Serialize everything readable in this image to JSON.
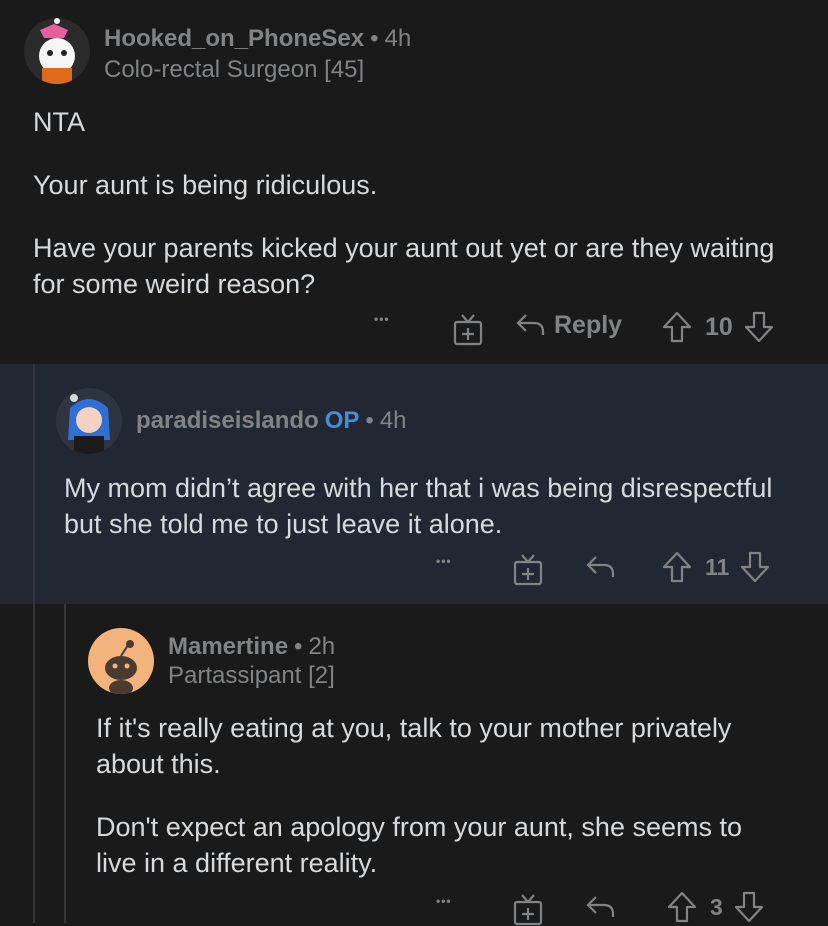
{
  "comments": [
    {
      "author": "Hooked_on_PhoneSex",
      "separator": "•",
      "age": "4h",
      "flair": "Colo-rectal Surgeon [45]",
      "paragraphs": [
        "NTA",
        "Your aunt is being ridiculous.",
        "Have your parents kicked your aunt out yet or are they waiting for some weird reason?"
      ],
      "more": "•••",
      "reply_label": "Reply",
      "score": "10"
    },
    {
      "author": "paradiseislando",
      "op_badge": "OP",
      "separator": "•",
      "age": "4h",
      "paragraphs": [
        "My mom didn’t agree with her that i was being disrespectful but she told me to just leave it alone."
      ],
      "more": "•••",
      "score": "11"
    },
    {
      "author": "Mamertine",
      "separator": "•",
      "age": "2h",
      "flair": "Partassipant [2]",
      "paragraphs": [
        "If it's really eating at you, talk to your mother privately about this.",
        "Don't expect an apology from your aunt, she seems to live in a different reality."
      ],
      "more": "•••",
      "score": "3"
    }
  ],
  "colors": {
    "background": "#1a1a1b",
    "highlight_background": "#222833",
    "op_blue": "#4a8bd6",
    "muted": "#818384",
    "text": "#d7dadc"
  },
  "icons": [
    "award-icon",
    "reply-icon",
    "upvote-icon",
    "downvote-icon",
    "more-icon"
  ]
}
